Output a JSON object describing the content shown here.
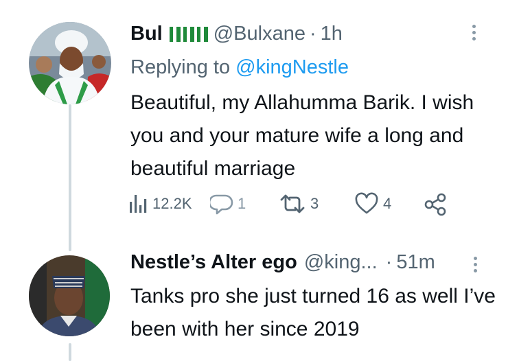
{
  "tweet": {
    "author_name": "Bul",
    "author_handle": "@Bulxane",
    "separator": "·",
    "time": "1h",
    "replying_prefix": "Replying to",
    "replying_to": "@kingNestle",
    "text": "Beautiful, my Allahumma Barik. I wish you and your mature wife a long and beautiful marriage",
    "stats": {
      "views": "12.2K",
      "replies": "1",
      "retweets": "3",
      "likes": "4"
    },
    "flag_colors": [
      "#1f8a3a",
      "#ffffff",
      "#1f8a3a"
    ]
  },
  "reply": {
    "author_name": "Nestle’s Alter ego",
    "author_handle": "@king...",
    "separator": "·",
    "time": "51m",
    "text": "Tanks pro she just turned 16 as well I’ve been with her since 2019"
  },
  "icons": [
    "views-icon",
    "reply-icon",
    "retweet-icon",
    "like-icon",
    "share-icon",
    "more-icon"
  ],
  "colors": {
    "accent": "#1d9bf0",
    "secondary_text": "#536471",
    "thread_line": "#cfd9de"
  }
}
